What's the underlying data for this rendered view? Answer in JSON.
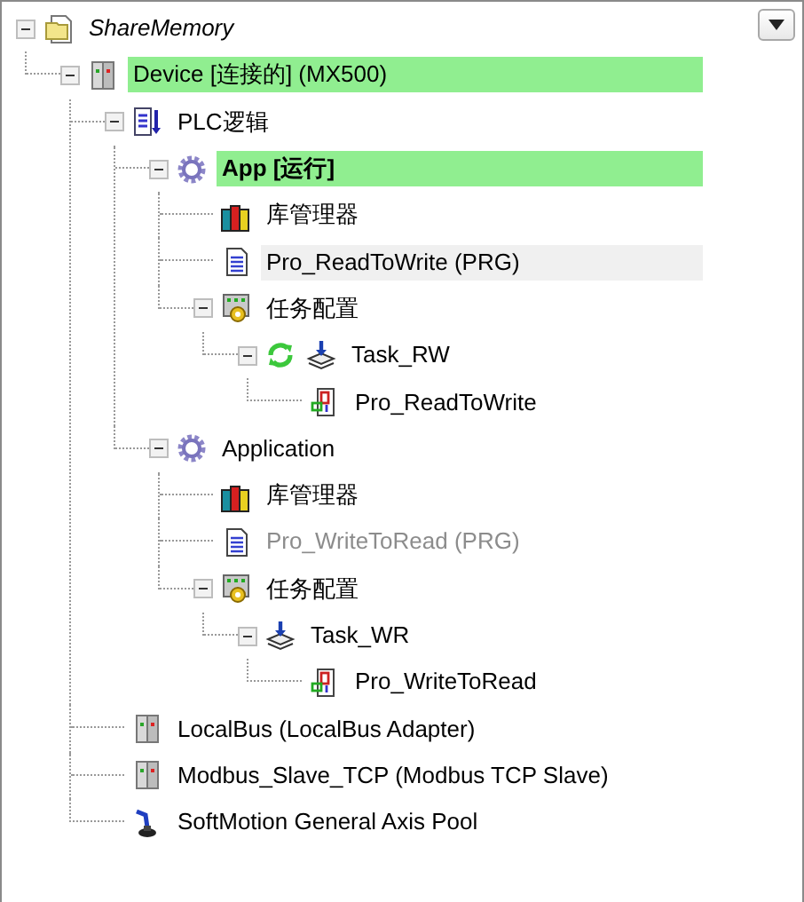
{
  "tree": {
    "label": "ShareMemory",
    "kind": "project",
    "expanded": true,
    "highlighted": false,
    "selected": false,
    "disabled": false,
    "active": false,
    "running": false,
    "italic": true,
    "children": [
      {
        "label": "Device [连接的] (MX500)",
        "kind": "device",
        "expanded": true,
        "highlighted": true,
        "selected": false,
        "disabled": false,
        "active": false,
        "running": false,
        "italic": false,
        "children": [
          {
            "label": "PLC逻辑",
            "kind": "plc-logic",
            "expanded": true,
            "highlighted": false,
            "selected": false,
            "disabled": false,
            "active": false,
            "running": false,
            "italic": false,
            "children": [
              {
                "label": "App [运行]",
                "kind": "application",
                "expanded": true,
                "highlighted": true,
                "selected": false,
                "disabled": false,
                "active": true,
                "running": false,
                "italic": false,
                "children": [
                  {
                    "label": "库管理器",
                    "kind": "library",
                    "highlighted": false,
                    "selected": false,
                    "disabled": false,
                    "active": false,
                    "running": false,
                    "italic": false
                  },
                  {
                    "label": "Pro_ReadToWrite (PRG)",
                    "kind": "pou",
                    "highlighted": false,
                    "selected": true,
                    "disabled": false,
                    "active": false,
                    "running": false,
                    "italic": false
                  },
                  {
                    "label": "任务配置",
                    "kind": "task-config",
                    "expanded": true,
                    "highlighted": false,
                    "selected": false,
                    "disabled": false,
                    "active": false,
                    "running": false,
                    "italic": false,
                    "children": [
                      {
                        "label": "Task_RW",
                        "kind": "task",
                        "expanded": true,
                        "highlighted": false,
                        "selected": false,
                        "disabled": false,
                        "active": false,
                        "running": true,
                        "italic": false,
                        "children": [
                          {
                            "label": "Pro_ReadToWrite",
                            "kind": "program-call",
                            "highlighted": false,
                            "selected": false,
                            "disabled": false,
                            "active": false,
                            "running": false,
                            "italic": false
                          }
                        ]
                      }
                    ]
                  }
                ]
              },
              {
                "label": "Application",
                "kind": "application",
                "expanded": true,
                "highlighted": false,
                "selected": false,
                "disabled": false,
                "active": false,
                "running": false,
                "italic": false,
                "children": [
                  {
                    "label": "库管理器",
                    "kind": "library",
                    "highlighted": false,
                    "selected": false,
                    "disabled": false,
                    "active": false,
                    "running": false,
                    "italic": false
                  },
                  {
                    "label": "Pro_WriteToRead (PRG)",
                    "kind": "pou",
                    "highlighted": false,
                    "selected": false,
                    "disabled": true,
                    "active": false,
                    "running": false,
                    "italic": false
                  },
                  {
                    "label": "任务配置",
                    "kind": "task-config",
                    "expanded": true,
                    "highlighted": false,
                    "selected": false,
                    "disabled": false,
                    "active": false,
                    "running": false,
                    "italic": false,
                    "children": [
                      {
                        "label": "Task_WR",
                        "kind": "task",
                        "expanded": true,
                        "highlighted": false,
                        "selected": false,
                        "disabled": false,
                        "active": false,
                        "running": false,
                        "italic": false,
                        "children": [
                          {
                            "label": "Pro_WriteToRead",
                            "kind": "program-call",
                            "highlighted": false,
                            "selected": false,
                            "disabled": false,
                            "active": false,
                            "running": false,
                            "italic": false
                          }
                        ]
                      }
                    ]
                  }
                ]
              }
            ]
          },
          {
            "label": "LocalBus (LocalBus Adapter)",
            "kind": "device",
            "highlighted": false,
            "selected": false,
            "disabled": false,
            "active": false,
            "running": false,
            "italic": false
          },
          {
            "label": "Modbus_Slave_TCP (Modbus TCP Slave)",
            "kind": "device",
            "highlighted": false,
            "selected": false,
            "disabled": false,
            "active": false,
            "running": false,
            "italic": false
          },
          {
            "label": "SoftMotion General Axis Pool",
            "kind": "axis-pool",
            "highlighted": false,
            "selected": false,
            "disabled": false,
            "active": false,
            "running": false,
            "italic": false
          }
        ]
      }
    ]
  }
}
